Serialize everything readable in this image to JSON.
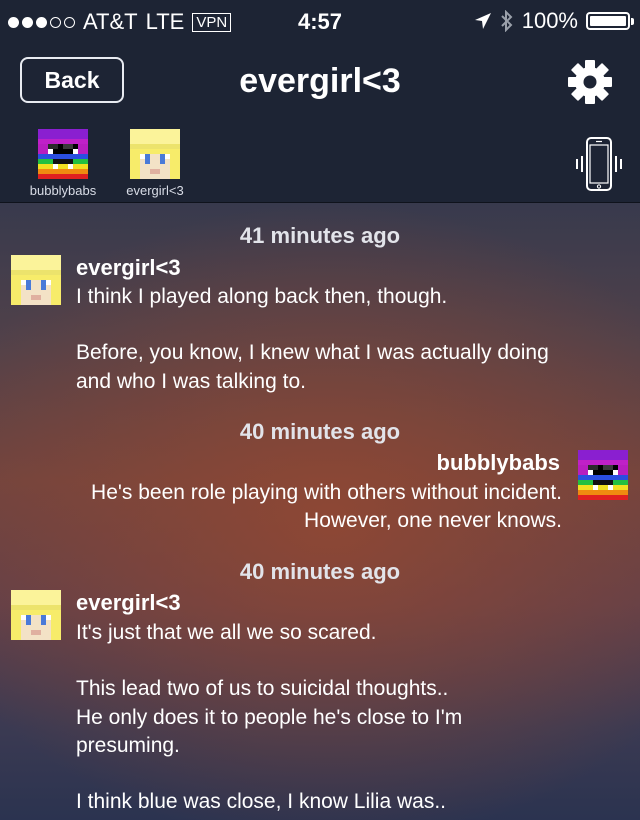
{
  "status_bar": {
    "carrier": "AT&T",
    "network": "LTE",
    "vpn": "VPN",
    "time": "4:57",
    "battery": "100%",
    "signal_bars": 3,
    "battery_level": 1.0,
    "icons": [
      "location-arrow-icon",
      "bluetooth-icon",
      "battery-icon"
    ]
  },
  "nav": {
    "back_label": "Back",
    "title": "evergirl<3",
    "settings_icon": "gear-icon"
  },
  "participants": [
    {
      "name": "bubblybabs",
      "avatar": "rainbow-pixel-avatar"
    },
    {
      "name": "evergirl<3",
      "avatar": "blonde-pixel-avatar"
    }
  ],
  "vibrate_icon": "phone-vibrate-icon",
  "messages": [
    {
      "timestamp": "41 minutes ago",
      "sender": "evergirl<3",
      "side": "left",
      "lines": [
        "I think I played along back then, though.",
        "",
        "Before, you know, I knew what I was actually doing",
        "and who I was talking to."
      ]
    },
    {
      "timestamp": "40 minutes ago",
      "sender": "bubblybabs",
      "side": "right",
      "lines": [
        "He's been role playing with others without incident.",
        "However, one never knows."
      ]
    },
    {
      "timestamp": "40 minutes ago",
      "sender": "evergirl<3",
      "side": "left",
      "lines": [
        "It's just that we all we so scared.",
        "",
        "This lead two of us to suicidal thoughts..",
        "He only does it to people he's close to I'm",
        "presuming.",
        "",
        "I think blue was close, I know Lilia was.."
      ]
    }
  ]
}
